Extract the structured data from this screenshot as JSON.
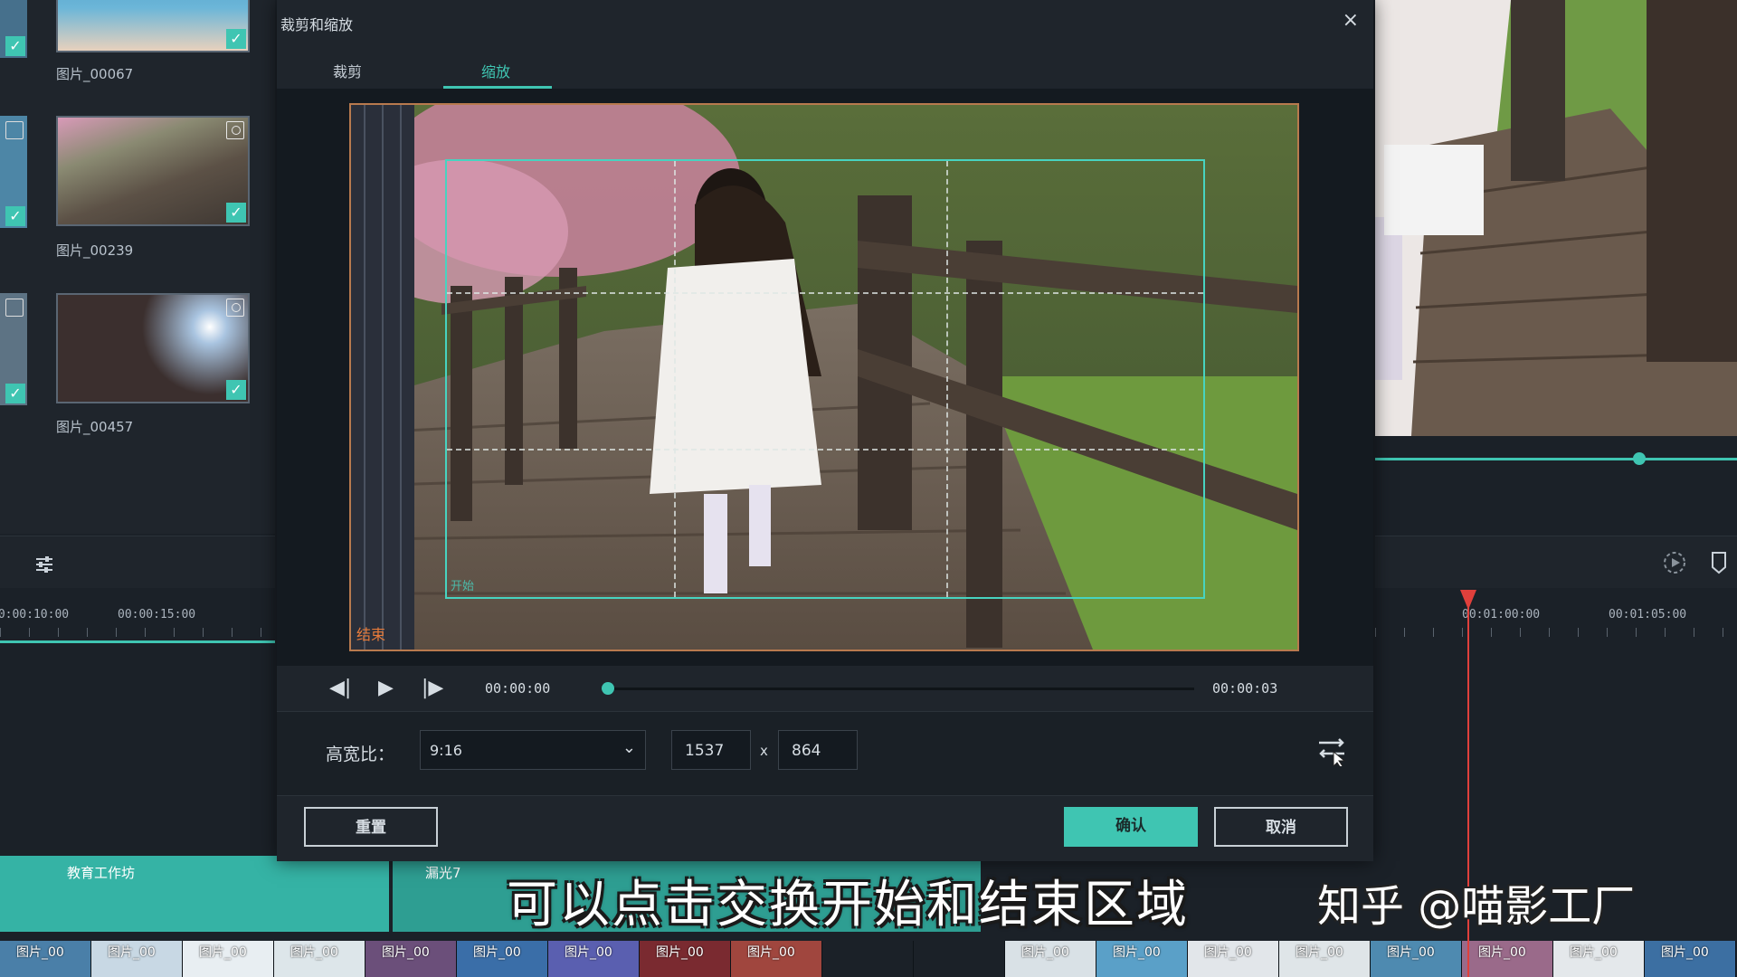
{
  "dialog": {
    "title": "裁剪和缩放",
    "close": "×",
    "tabs": [
      {
        "label": "裁剪",
        "active": false
      },
      {
        "label": "缩放",
        "active": true
      }
    ],
    "preview_start_label": "开始",
    "preview_end_label": "结束",
    "player": {
      "current_time": "00:00:00",
      "duration": "00:00:03",
      "progress": 0
    },
    "aspect": {
      "label": "高宽比：",
      "selected": "9:16",
      "width": "1537",
      "height": "864",
      "separator": "x"
    },
    "buttons": {
      "reset": "重置",
      "ok": "确认",
      "cancel": "取消"
    }
  },
  "media_library": {
    "items": [
      {
        "label": "图片_00067"
      },
      {
        "label": "图片_00239"
      },
      {
        "label": "图片_00457"
      }
    ],
    "checked_icon": "checkmark-icon",
    "type_icon": "image-icon"
  },
  "timeline": {
    "left_ticks": [
      "00:00:10:00",
      "00:00:15:00"
    ],
    "right_ticks": [
      "00:01:00:00",
      "00:01:05:00"
    ],
    "clips": [
      {
        "label": "教育工作坊"
      },
      {
        "label": "漏光7"
      }
    ],
    "film_label": "图片_00",
    "playhead_color": "#e0403c"
  },
  "preview_slider_progress": 0.73,
  "accent_color": "#3fc5b2",
  "caption": "可以点击交换开始和结束区域",
  "watermark": "知乎 @喵影工厂"
}
